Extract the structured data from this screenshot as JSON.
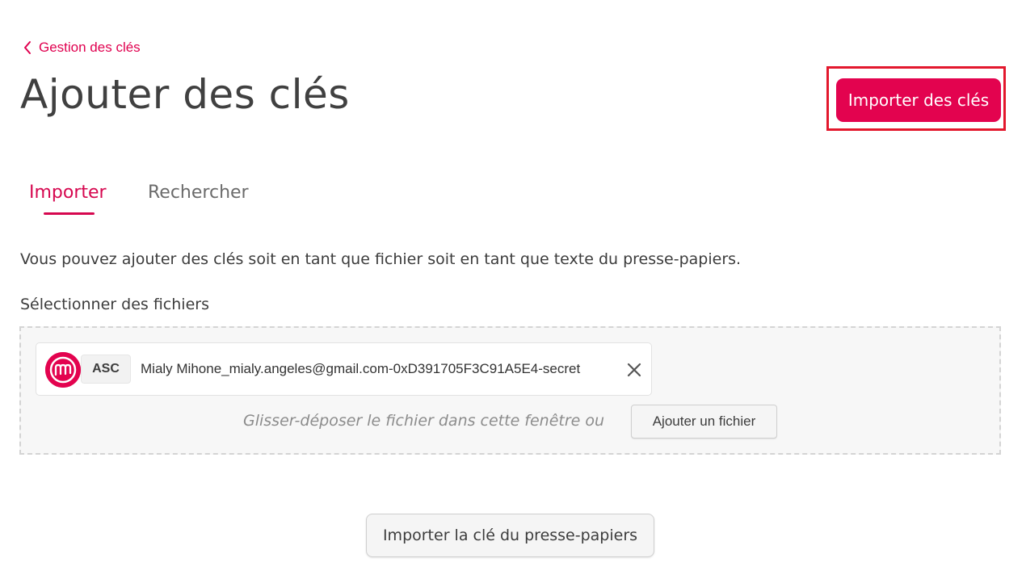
{
  "breadcrumb": {
    "label": "Gestion des clés",
    "icon": "chevron-left-icon"
  },
  "page_title": "Ajouter des clés",
  "header_action": {
    "label": "Importer des clés",
    "color": "#e3034f",
    "highlight_color": "#e3182d"
  },
  "tabs": [
    {
      "label": "Importer",
      "active": true
    },
    {
      "label": "Rechercher",
      "active": false
    }
  ],
  "description": "Vous pouvez ajouter des clés soit en tant que fichier soit en tant que texte du presse-papiers.",
  "files_section": {
    "label": "Sélectionner des fichiers",
    "files": [
      {
        "icon": "mailvelope-logo-icon",
        "type": "ASC",
        "name": "Mialy Mihone_mialy.angeles@gmail.com-0xD391705F3C91A5E4-secret",
        "remove_icon": "close-icon"
      }
    ],
    "drop_hint": "Glisser-déposer le fichier dans cette fenêtre ou",
    "add_file_label": "Ajouter un fichier"
  },
  "clipboard_button": {
    "label": "Importer la clé du presse-papiers"
  },
  "colors": {
    "accent": "#e3034f",
    "text": "#3c3c3c",
    "muted": "#8c8c8c"
  }
}
